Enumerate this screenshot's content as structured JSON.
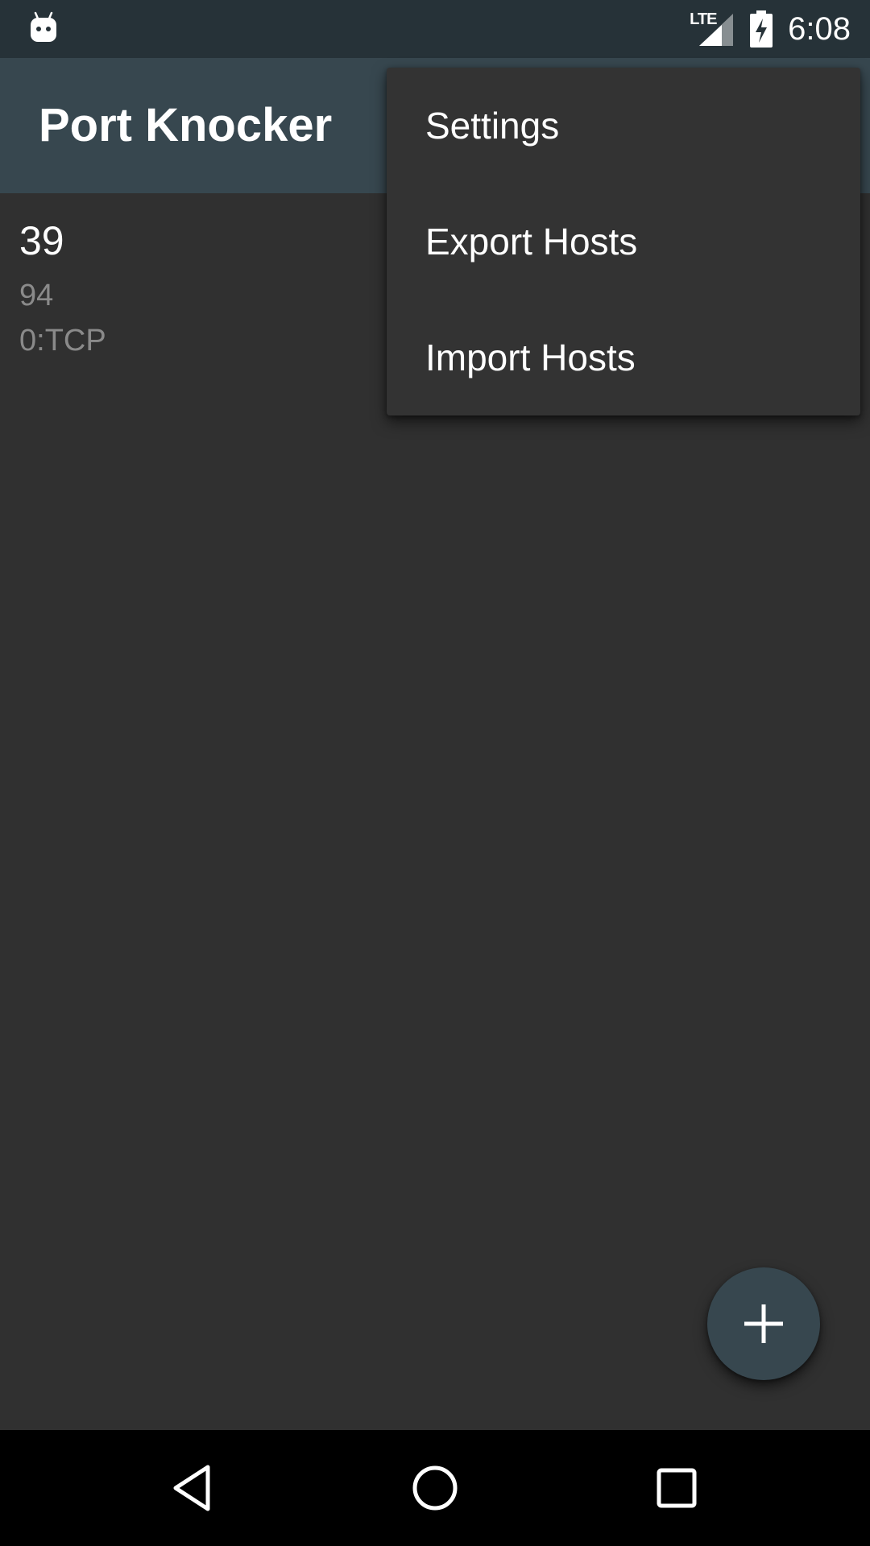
{
  "status_bar": {
    "time": "6:08",
    "network_label": "LTE",
    "icons": [
      "android-debug-icon",
      "lte-signal-icon",
      "battery-charging-icon"
    ]
  },
  "app_bar": {
    "title": "Port Knocker"
  },
  "hosts": [
    {
      "name": "39",
      "line1": "94",
      "line2": "0:TCP"
    }
  ],
  "overflow_menu": {
    "items": [
      {
        "label": "Settings"
      },
      {
        "label": "Export Hosts"
      },
      {
        "label": "Import Hosts"
      }
    ]
  },
  "fab": {
    "icon": "plus-icon"
  },
  "nav_bar": {
    "icons": [
      "back-icon",
      "home-icon",
      "recents-icon"
    ]
  },
  "colors": {
    "status_bar": "#263238",
    "app_bar": "#37474f",
    "background": "#303030",
    "menu_background": "#333333",
    "fab": "#37474f",
    "secondary_text": "#8a8a8a"
  }
}
